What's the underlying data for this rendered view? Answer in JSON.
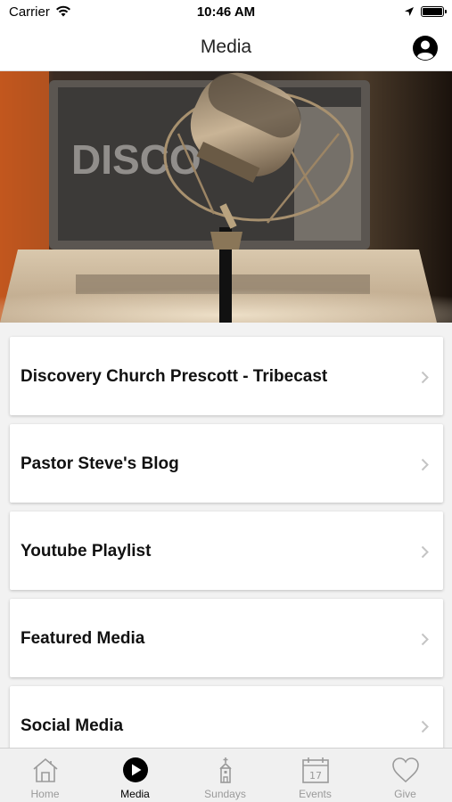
{
  "status": {
    "carrier": "Carrier",
    "time": "10:46 AM"
  },
  "header": {
    "title": "Media"
  },
  "hero": {
    "alt": ""
  },
  "menu": [
    {
      "label": "Discovery Church Prescott - Tribecast"
    },
    {
      "label": "Pastor Steve's Blog"
    },
    {
      "label": "Youtube Playlist"
    },
    {
      "label": "Featured Media"
    },
    {
      "label": "Social Media"
    }
  ],
  "tabs": [
    {
      "label": "Home",
      "icon": "home-icon"
    },
    {
      "label": "Media",
      "icon": "play-icon",
      "active": true
    },
    {
      "label": "Sundays",
      "icon": "church-icon"
    },
    {
      "label": "Events",
      "icon": "calendar-icon",
      "day": "17"
    },
    {
      "label": "Give",
      "icon": "heart-icon"
    }
  ],
  "colors": {
    "accent": "#000000",
    "inactive": "#9a9a9a",
    "tabbar": "#f0f0f0"
  }
}
